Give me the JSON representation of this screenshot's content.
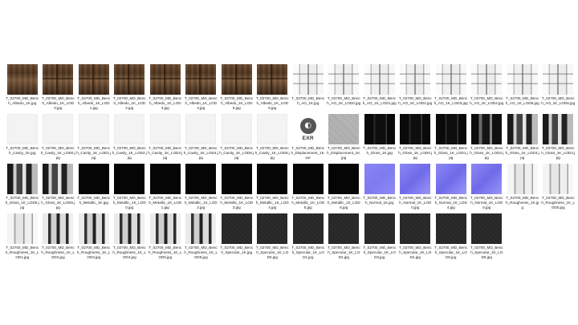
{
  "files": [
    {
      "name": "T_02700_MD_Bench_Albedo_1K.jpg",
      "thumb": "albedo"
    },
    {
      "name": "T_02700_MD_Bench_Albedo_1K_LOD0.jpg",
      "thumb": "albedo lod"
    },
    {
      "name": "T_02700_MD_Bench_Albedo_1K_LOD1.jpg",
      "thumb": "albedo lod"
    },
    {
      "name": "T_02700_MD_Bench_Albedo_1K_LOD2.jpg",
      "thumb": "albedo lod"
    },
    {
      "name": "T_02700_MD_Bench_Albedo_1K_LOD3.jpg",
      "thumb": "albedo lod"
    },
    {
      "name": "T_02700_MD_Bench_Albedo_1K_LOD4.jpg",
      "thumb": "albedo lod"
    },
    {
      "name": "T_02700_MD_Bench_Albedo_1K_LOD5.jpg",
      "thumb": "albedo lod"
    },
    {
      "name": "T_02700_MD_Bench_Albedo_1K_LOD6.jpg",
      "thumb": "albedo lod"
    },
    {
      "name": "T_02700_MD_Bench_AO_1K.jpg",
      "thumb": "ao"
    },
    {
      "name": "T_02700_MD_Bench_AO_1K_LOD0.jpg",
      "thumb": "ao"
    },
    {
      "name": "T_02700_MD_Bench_AO_1K_LOD1.jpg",
      "thumb": "ao"
    },
    {
      "name": "T_02700_MD_Bench_AO_1K_LOD2.jpg",
      "thumb": "ao"
    },
    {
      "name": "T_02700_MD_Bench_AO_1K_LOD3.jpg",
      "thumb": "ao"
    },
    {
      "name": "T_02700_MD_Bench_AO_1K_LOD4.jpg",
      "thumb": "ao"
    },
    {
      "name": "T_02700_MD_Bench_AO_1K_LOD5.jpg",
      "thumb": "ao"
    },
    {
      "name": "T_02700_MD_Bench_AO_1K_LOD6.jpg",
      "thumb": "ao"
    },
    {
      "name": "T_02700_MD_Bench_Cavity_1K.jpg",
      "thumb": "white"
    },
    {
      "name": "T_02700_MD_Bench_Cavity_1K_LOD0.jpg",
      "thumb": "white"
    },
    {
      "name": "T_02700_MD_Bench_Cavity_1K_LOD1.jpg",
      "thumb": "white"
    },
    {
      "name": "T_02700_MD_Bench_Cavity_1K_LOD2.jpg",
      "thumb": "white"
    },
    {
      "name": "T_02700_MD_Bench_Cavity_1K_LOD3.jpg",
      "thumb": "white"
    },
    {
      "name": "T_02700_MD_Bench_Cavity_1K_LOD4.jpg",
      "thumb": "white"
    },
    {
      "name": "T_02700_MD_Bench_Cavity_1K_LOD5.jpg",
      "thumb": "white"
    },
    {
      "name": "T_02700_MD_Bench_Cavity_1K_LOD6.jpg",
      "thumb": "white"
    },
    {
      "name": "T_02700_MD_Bench_Displacement_1K.exr",
      "thumb": "exr",
      "exr_text": "EXR"
    },
    {
      "name": "T_02700_MD_Bench_Displacement_1K.jpg",
      "thumb": "disp"
    },
    {
      "name": "T_02700_MD_Bench_Gloss_1K.jpg",
      "thumb": "gloss"
    },
    {
      "name": "T_02700_MD_Bench_Gloss_1K_LOD0.jpg",
      "thumb": "gloss"
    },
    {
      "name": "T_02700_MD_Bench_Gloss_1K_LOD1.jpg",
      "thumb": "gloss"
    },
    {
      "name": "T_02700_MD_Bench_Gloss_1K_LOD2.jpg",
      "thumb": "gloss mid"
    },
    {
      "name": "T_02700_MD_Bench_Gloss_1K_LOD3.jpg",
      "thumb": "gloss light"
    },
    {
      "name": "T_02700_MD_Bench_Gloss_1K_LOD4.jpg",
      "thumb": "gloss light"
    },
    {
      "name": "T_02700_MD_Bench_Gloss_1K_LOD5.jpg",
      "thumb": "gloss light"
    },
    {
      "name": "T_02700_MD_Bench_Gloss_1K_LOD6.jpg",
      "thumb": "gloss light"
    },
    {
      "name": "T_02700_MD_Bench_Metallic_1K.jpg",
      "thumb": "black"
    },
    {
      "name": "T_02700_MD_Bench_Metallic_1K_LOD0.jpg",
      "thumb": "black"
    },
    {
      "name": "T_02700_MD_Bench_Metallic_1K_LOD1.jpg",
      "thumb": "black"
    },
    {
      "name": "T_02700_MD_Bench_Metallic_1K_LOD2.jpg",
      "thumb": "black"
    },
    {
      "name": "T_02700_MD_Bench_Metallic_1K_LOD3.jpg",
      "thumb": "black"
    },
    {
      "name": "T_02700_MD_Bench_Metallic_1K_LOD4.jpg",
      "thumb": "black"
    },
    {
      "name": "T_02700_MD_Bench_Metallic_1K_LOD5.jpg",
      "thumb": "black"
    },
    {
      "name": "T_02700_MD_Bench_Metallic_1K_LOD6.jpg",
      "thumb": "black"
    },
    {
      "name": "T_02700_MD_Bench_Normal_1K.jpg",
      "thumb": "normal"
    },
    {
      "name": "T_02700_MD_Bench_Normal_1K_LOD0.jpg",
      "thumb": "normal lod"
    },
    {
      "name": "T_02700_MD_Bench_Normal_1K_LOD4.jpg",
      "thumb": "normal lod"
    },
    {
      "name": "T_02700_MD_Bench_Normal_1K_LOD5.jpg",
      "thumb": "normal lod"
    },
    {
      "name": "T_02700_MD_Bench_Roughness_1K.jpg",
      "thumb": "rough"
    },
    {
      "name": "T_02700_MD_Bench_Roughness_1K_LOD0.jpg",
      "thumb": "rough"
    },
    {
      "name": "T_02700_MD_Bench_Roughness_1K_LOD1.jpg",
      "thumb": "rough"
    },
    {
      "name": "T_02700_MD_Bench_Roughness_1K_LOD2.jpg",
      "thumb": "rough dark"
    },
    {
      "name": "T_02700_MD_Bench_Roughness_1K_LOD3.jpg",
      "thumb": "rough dark"
    },
    {
      "name": "T_02700_MD_Bench_Roughness_1K_LOD4.jpg",
      "thumb": "rough dark"
    },
    {
      "name": "T_02700_MD_Bench_Roughness_1K_LOD6.jpg",
      "thumb": "rough dark"
    },
    {
      "name": "T_02700_MD_Bench_Roughness_1K_LOD6.jpg",
      "thumb": "rough dark"
    },
    {
      "name": "T_02700_MD_Bench_Specular_1K.jpg",
      "thumb": "specular"
    },
    {
      "name": "T_02700_MD_Bench_Specular_1K_LOD0.jpg",
      "thumb": "specular"
    },
    {
      "name": "T_02700_MD_Bench_Specular_1K_LOD1.jpg",
      "thumb": "specular"
    },
    {
      "name": "T_02700_MD_Bench_Specular_1K_LOD2.jpg",
      "thumb": "specular"
    },
    {
      "name": "T_02700_MD_Bench_Specular_1K_LOD3.jpg",
      "thumb": "specular"
    },
    {
      "name": "T_02700_MD_Bench_Specular_1K_LOD4.jpg",
      "thumb": "specular"
    },
    {
      "name": "T_02700_MD_Bench_Specular_1K_LOD5.jpg",
      "thumb": "specular"
    },
    {
      "name": "T_02700_MD_Bench_Specular_1K_LOD6.jpg",
      "thumb": "specular"
    }
  ]
}
